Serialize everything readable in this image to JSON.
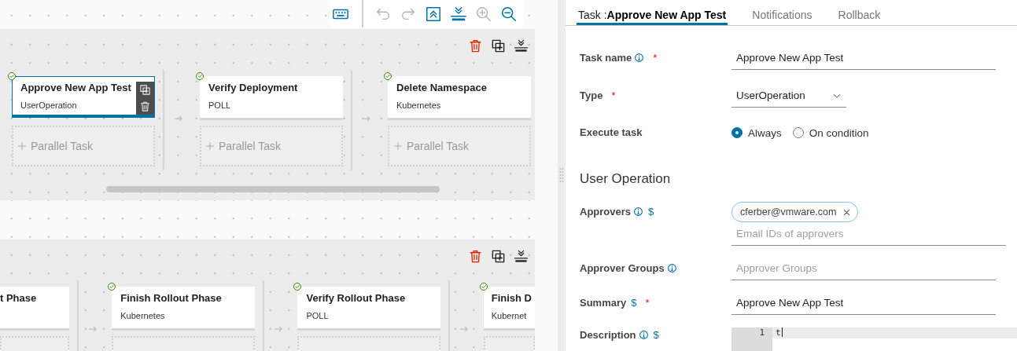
{
  "toolbar": {
    "buttons": [
      {
        "kind": "keyboard",
        "disabled": false
      },
      {
        "kind": "undo",
        "disabled": true
      },
      {
        "kind": "redo",
        "disabled": true
      },
      {
        "kind": "collapse",
        "disabled": false
      },
      {
        "kind": "expand",
        "disabled": false
      },
      {
        "kind": "zoom-in",
        "disabled": true
      },
      {
        "kind": "zoom-out",
        "disabled": false
      }
    ]
  },
  "stages": [
    {
      "tasks": [
        {
          "name": "Approve New App Test",
          "type": "UserOperation",
          "selected": true,
          "parallel_task": "Parallel Task"
        },
        {
          "name": "Verify Deployment",
          "type": "POLL",
          "selected": false,
          "parallel_task": "Parallel Task"
        },
        {
          "name": "Delete Namespace",
          "type": "Kubernetes",
          "selected": false,
          "parallel_task": "Parallel Task"
        }
      ]
    },
    {
      "tasks": [
        {
          "name": "t Phase",
          "selected": false
        },
        {
          "name": "Finish Rollout Phase",
          "type": "Kubernetes",
          "selected": false
        },
        {
          "name": "Verify Rollout Phase",
          "type": "POLL",
          "selected": false
        },
        {
          "name": "Finish D",
          "type": "Kubernet",
          "selected": false
        }
      ]
    }
  ],
  "panel": {
    "tabs": [
      {
        "label": "Task :**Approve New App Test**",
        "selected": true
      },
      {
        "label": "Notifications",
        "selected": false
      },
      {
        "label": "Rollback",
        "selected": false
      }
    ],
    "fields": [
      {
        "kind": "text",
        "label": "Task name",
        "info": true,
        "required": "*",
        "value": "Approve New App Test"
      },
      {
        "kind": "select",
        "label": "Type",
        "required": "*",
        "value": "UserOperation"
      },
      {
        "kind": "radio",
        "label": "Execute task",
        "options": [
          {
            "label": "Always",
            "selected": true
          },
          {
            "label": "On condition",
            "selected": false
          }
        ]
      },
      {
        "kind": "heading",
        "label": "User Operation"
      },
      {
        "kind": "chips",
        "label": "Approvers",
        "info": true,
        "variable": "$",
        "chips": [
          "cferber@vmware.com"
        ],
        "placeholder": "Email IDs of approvers"
      },
      {
        "kind": "text",
        "label": "Approver Groups",
        "info": true,
        "placeholder": "Approver Groups"
      },
      {
        "kind": "text",
        "label": "Summary",
        "variable": "$",
        "required": "*",
        "value": "Approve New App Test"
      },
      {
        "kind": "code",
        "label": "Description",
        "info": true,
        "variable": "$",
        "lines": [
          {
            "number": "1",
            "text": "t"
          }
        ]
      }
    ]
  }
}
